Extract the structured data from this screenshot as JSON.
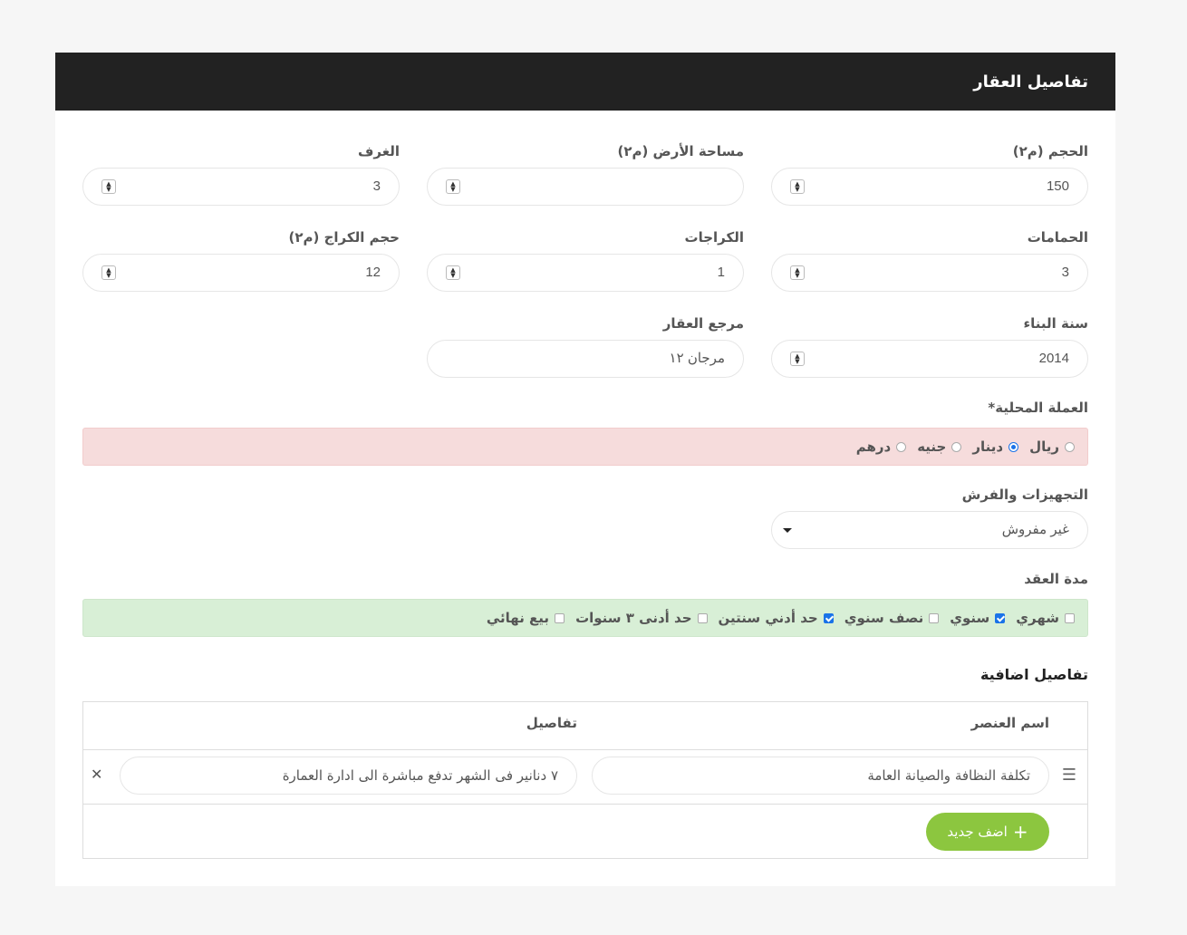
{
  "panel": {
    "title": "تفاصيل العقار"
  },
  "fields": {
    "size": {
      "label": "الحجم (م٢)",
      "value": "150"
    },
    "land_area": {
      "label": "مساحة الأرض (م٢)",
      "value": ""
    },
    "rooms": {
      "label": "الغرف",
      "value": "3"
    },
    "bathrooms": {
      "label": "الحمامات",
      "value": "3"
    },
    "garages": {
      "label": "الكراجات",
      "value": "1"
    },
    "garage_size": {
      "label": "حجم الكراج (م٢)",
      "value": "12"
    },
    "year_built": {
      "label": "سنة البناء",
      "value": "2014"
    },
    "reference": {
      "label": "مرجع العقار",
      "value": "مرجان ١٢"
    }
  },
  "currency": {
    "label": "العملة المحلية*",
    "options": [
      {
        "label": "ريال",
        "selected": false
      },
      {
        "label": "دينار",
        "selected": true
      },
      {
        "label": "جنيه",
        "selected": false
      },
      {
        "label": "درهم",
        "selected": false
      }
    ]
  },
  "furnishing": {
    "label": "التجهيزات والفرش",
    "value": "غير مفروش"
  },
  "contract": {
    "label": "مدة العقد",
    "options": [
      {
        "label": "شهري",
        "checked": false
      },
      {
        "label": "سنوي",
        "checked": true
      },
      {
        "label": "نصف سنوي",
        "checked": false
      },
      {
        "label": "حد أدني سنتين",
        "checked": true
      },
      {
        "label": "حد أدنى ٣ سنوات",
        "checked": false
      },
      {
        "label": "بيع نهائي",
        "checked": false
      }
    ]
  },
  "extra": {
    "title": "تفاصيل اضافية",
    "col_name": "اسم العنصر",
    "col_details": "تفاصيل",
    "rows": [
      {
        "name": "تكلفة النظافة والصيانة العامة",
        "details": "٧ دنانير فى الشهر تدفع مباشرة الى ادارة العمارة"
      }
    ],
    "add_label": "اضف جديد"
  },
  "icons": {
    "handle": "menu-icon",
    "remove": "close-icon",
    "add": "plus-icon",
    "spin": "spinner-icon",
    "caret": "caret-down-icon"
  },
  "colors": {
    "header_bg": "#222222",
    "error_bg": "#f6dcdc",
    "success_bg": "#d8efd6",
    "add_button": "#8cc63f",
    "accent": "#1a73e8"
  }
}
